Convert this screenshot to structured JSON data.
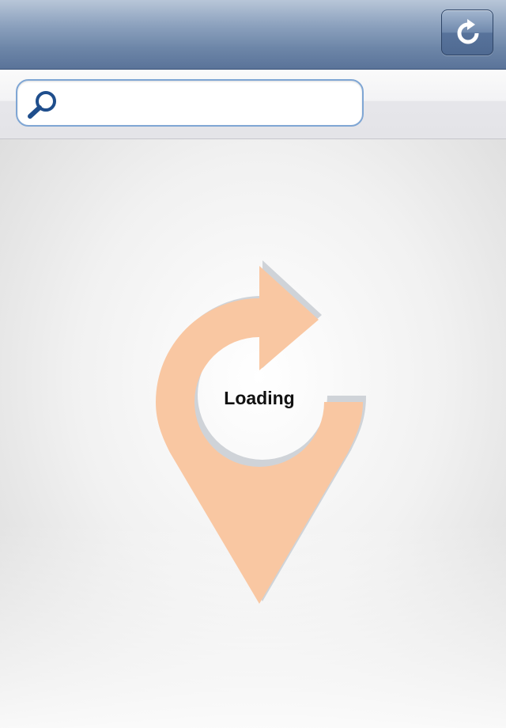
{
  "navbar": {
    "refresh_icon": "refresh-icon"
  },
  "search": {
    "icon": "search-icon",
    "value": "",
    "placeholder": ""
  },
  "loader": {
    "label": "Loading",
    "icon": "location-pin-refresh-icon",
    "color": "#f9c7a2"
  },
  "colors": {
    "navbar": "#6d86a8",
    "search_border": "#7fa6d4",
    "search_icon": "#1f4e8c"
  }
}
